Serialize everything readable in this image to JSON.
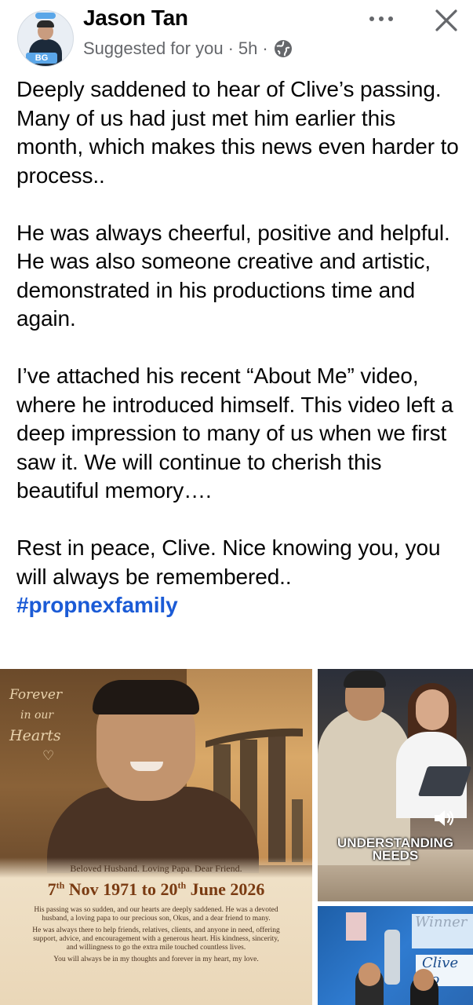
{
  "post": {
    "author": "Jason Tan",
    "avatar_badge": "BG",
    "meta": {
      "label": "Suggested for you",
      "separator": "·",
      "time": "5h",
      "separator2": "·",
      "audience_icon": "globe-icon"
    },
    "more_icon": "ellipsis-icon",
    "close_icon": "close-icon",
    "paragraphs": [
      "Deeply saddened to hear of Clive’s passing. Many of us had just met him earlier this month, which makes this news even harder to process..",
      "He was always cheerful, positive and helpful. He was also someone creative and artistic, demonstrated in his productions time and again.",
      "I’ve attached his recent “About Me” video, where he introduced himself. This video left a deep impression to many of us when we first saw it. We will continue to cherish this beautiful memory….",
      "Rest in peace, Clive. Nice knowing you, you will always be remembered.."
    ],
    "hashtag": "#propnexfamily",
    "hashtag_color": "#1b5bd6"
  },
  "media": {
    "memorial": {
      "forever_line1": "Forever",
      "forever_line2": "in our",
      "forever_line3": "Hearts",
      "heart_glyph": "♡",
      "beloved": "Beloved Husband. Loving Papa. Dear Friend.",
      "date_start_day": "7",
      "date_start_suffix": "th",
      "date_start_rest": " Nov 1971 to 20",
      "date_end_suffix": "th",
      "date_end_rest": " June 2026",
      "tribute_1": "His passing was so sudden, and our hearts are deeply saddened. He was a devoted husband, a loving papa to our precious son, Okus, and a dear friend to many.",
      "tribute_2": "He was always there to help friends, relatives, clients, and anyone in need, offering support, advice, and encouragement with a generous heart. His kindness, sincerity, and willingness to go the extra mile touched countless lives.",
      "tribute_3": "You will always be in my thoughts and forever in my heart, my love."
    },
    "video": {
      "caption_line1": "UNDERSTANDING",
      "caption_line2": "NEEDS",
      "sound_icon": "speaker-icon"
    },
    "award": {
      "banner_text": "Winner",
      "banner_text2": "Clive Fo"
    }
  }
}
